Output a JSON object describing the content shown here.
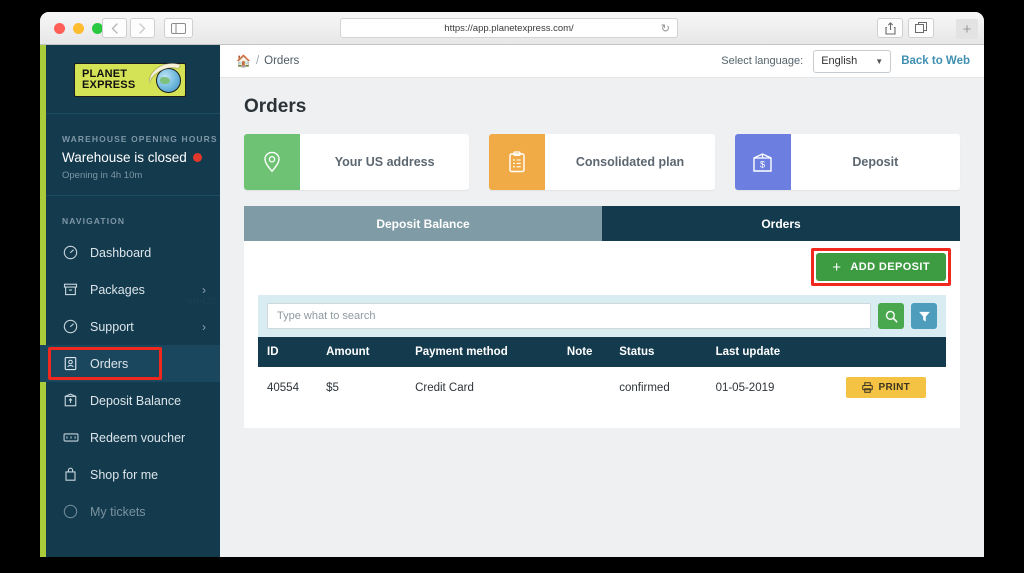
{
  "browser": {
    "url": "https://app.planetexpress.com/",
    "back_icon": "chevron-left-icon",
    "forward_icon": "chevron-right-icon",
    "sidebar_icon": "sidebar-toggle-icon",
    "reload_icon": "reload-icon",
    "share_icon": "share-icon",
    "tabs_icon": "show-tabs-icon",
    "newtab_label": "+"
  },
  "sidebar": {
    "logo": {
      "line1": "PLANET",
      "line2": "EXPRESS"
    },
    "warehouse": {
      "section_label": "WAREHOUSE OPENING HOURS",
      "status": "Warehouse is closed",
      "status_color": "#e2372b",
      "subtext": "Opening in 4h 10m"
    },
    "nav_label": "NAVIGATION",
    "locale": "en-US",
    "items": [
      {
        "label": "Dashboard",
        "icon": "dashboard-icon",
        "chevron": false,
        "active": false
      },
      {
        "label": "Packages",
        "icon": "box-icon",
        "chevron": true,
        "active": false
      },
      {
        "label": "Support",
        "icon": "support-icon",
        "chevron": true,
        "active": false
      },
      {
        "label": "Orders",
        "icon": "orders-icon",
        "chevron": false,
        "active": true,
        "highlighted": true
      },
      {
        "label": "Deposit Balance",
        "icon": "deposit-icon",
        "chevron": false,
        "active": false
      },
      {
        "label": "Redeem voucher",
        "icon": "voucher-icon",
        "chevron": false,
        "active": false
      },
      {
        "label": "Shop for me",
        "icon": "bag-icon",
        "chevron": false,
        "active": false
      },
      {
        "label": "My tickets",
        "icon": "ticket-icon",
        "chevron": false,
        "active": false
      }
    ]
  },
  "topbar": {
    "home_icon": "home-icon",
    "separator": "/",
    "breadcrumb_current": "Orders",
    "language_label": "Select language:",
    "language_value": "English",
    "back_to_web": "Back to Web"
  },
  "main": {
    "page_title": "Orders",
    "cards": [
      {
        "label": "Your US address",
        "icon": "map-pin-icon",
        "color": "#6ec273"
      },
      {
        "label": "Consolidated plan",
        "icon": "clipboard-icon",
        "color": "#f0ab46"
      },
      {
        "label": "Deposit",
        "icon": "deposit-box-icon",
        "color": "#6c7fe0"
      }
    ],
    "tabs": [
      {
        "label": "Deposit Balance",
        "active": false
      },
      {
        "label": "Orders",
        "active": true
      }
    ],
    "add_deposit": {
      "plus": "+",
      "label": "ADD DEPOSIT",
      "highlight_color": "#f0281e"
    },
    "search": {
      "placeholder": "Type what to search",
      "value": "",
      "search_icon": "search-icon",
      "filter_icon": "filter-icon"
    },
    "table": {
      "columns": [
        "ID",
        "Amount",
        "Payment method",
        "Note",
        "Status",
        "Last update",
        ""
      ],
      "rows": [
        {
          "id": "40554",
          "amount": "$5",
          "payment_method": "Credit Card",
          "note": "",
          "status": "confirmed",
          "last_update": "01-05-2019",
          "action_label": "PRINT",
          "action_icon": "printer-icon"
        }
      ]
    }
  }
}
